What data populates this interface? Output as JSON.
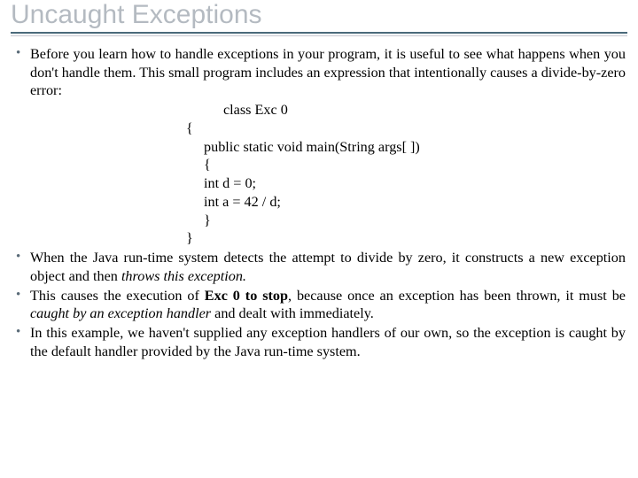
{
  "title": "Uncaught Exceptions",
  "bullets": {
    "b1": "Before you learn how to handle exceptions in your program, it is useful to see what happens when you don't handle them. This small program includes an expression that intentionally causes a divide-by-zero error:",
    "b2_pre": "When the Java run-time system detects the attempt to divide by zero, it constructs a new exception object and then ",
    "b2_italic": "throws this exception.",
    "b3_pre": "This causes the execution of ",
    "b3_bold": "Exc 0 to stop",
    "b3_mid": ", because once an exception has been thrown, it must be ",
    "b3_italic": "caught by an exception handler",
    "b3_post": " and dealt with immediately.",
    "b4": "In this example, we haven't supplied any exception handlers of our own, so the exception is caught by the default handler provided by the Java run-time system."
  },
  "code": {
    "l1": "class Exc 0",
    "l2": "{",
    "l3": "public static void main(String args[ ])",
    "l4": "{",
    "l5": "int d = 0;",
    "l6": "int a = 42 / d;",
    "l7": "}",
    "l8": "}"
  }
}
